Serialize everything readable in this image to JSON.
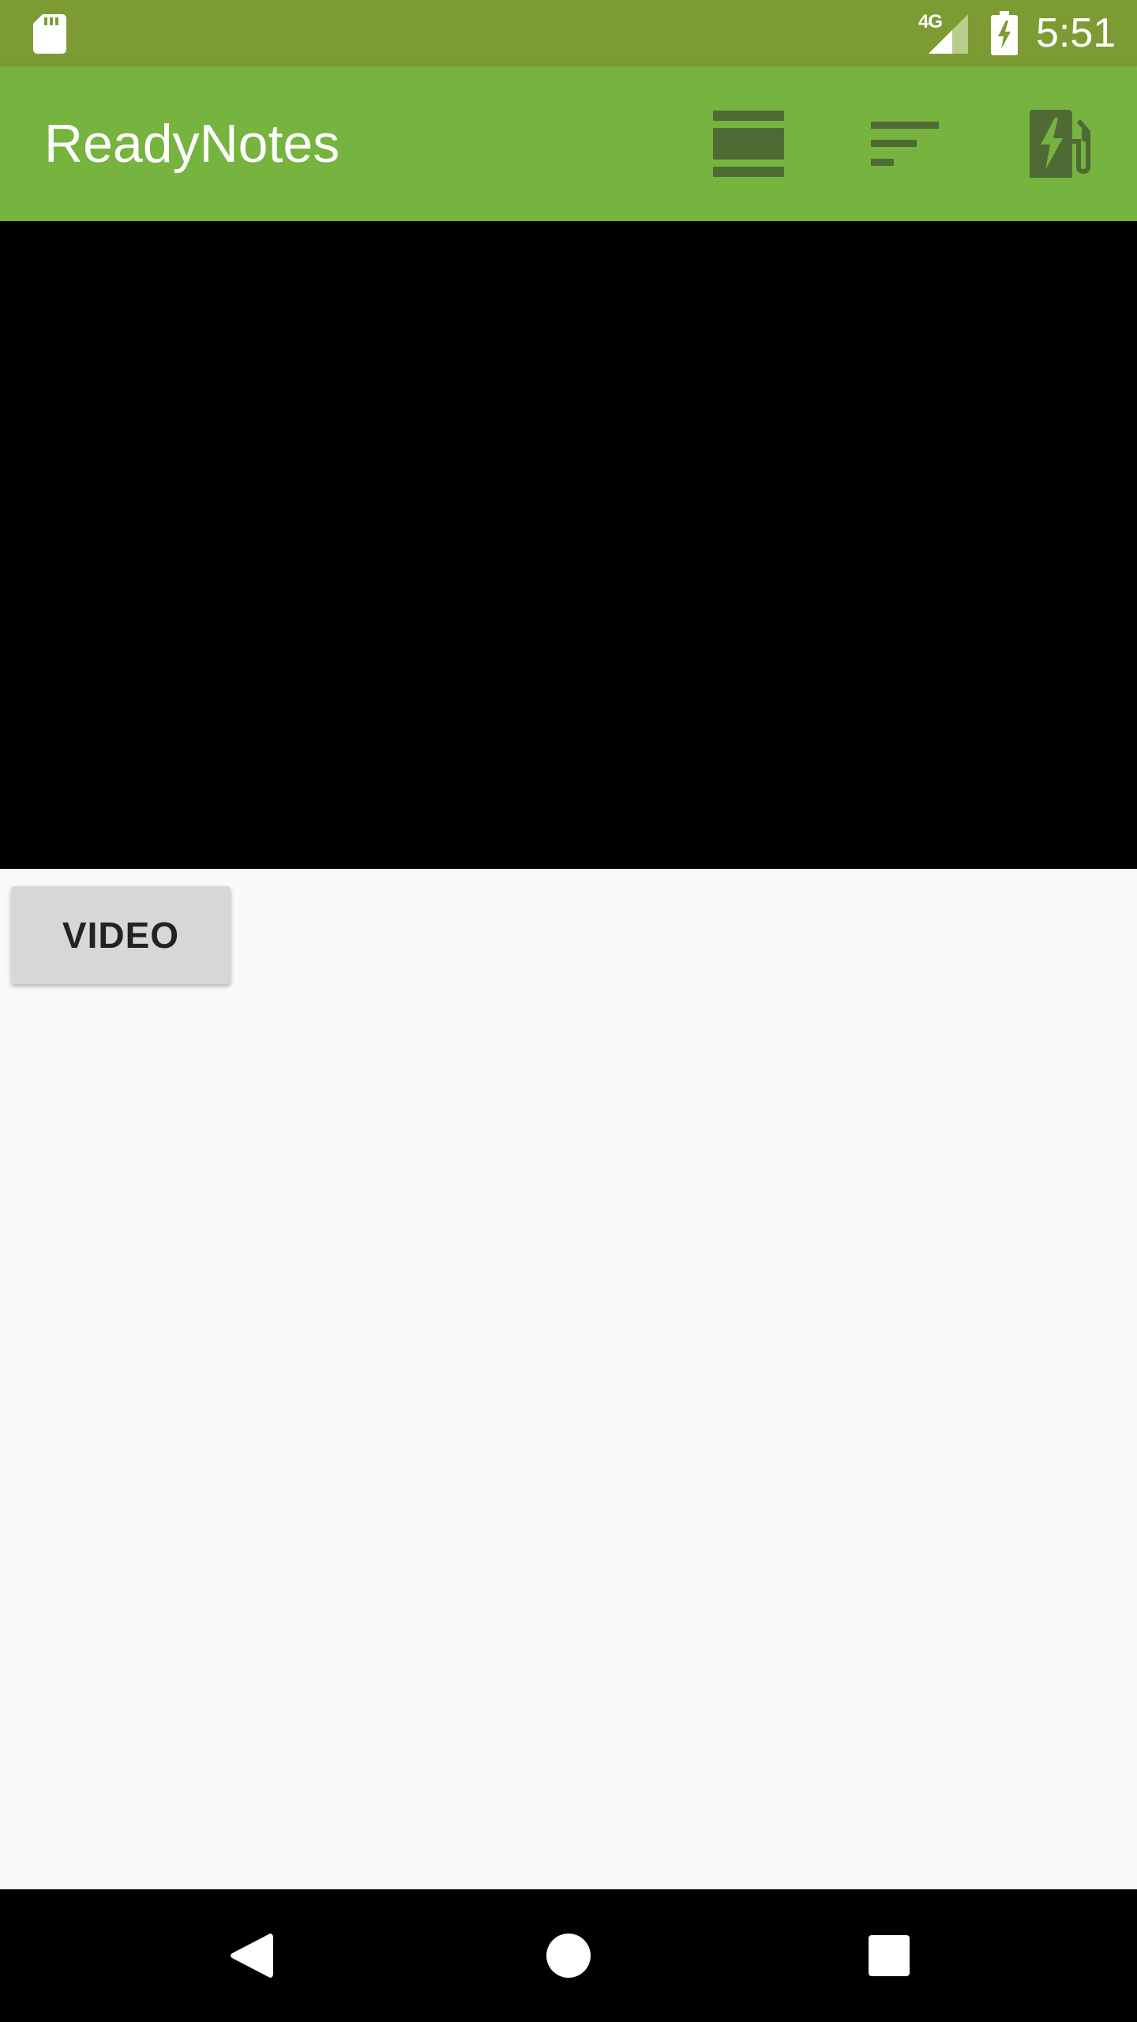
{
  "status_bar": {
    "network_type": "4G",
    "time": "5:51",
    "icons": [
      "sd-card-icon",
      "signal-icon",
      "battery-charging-icon"
    ]
  },
  "app_bar": {
    "title": "ReadyNotes",
    "actions": [
      {
        "icon": "view-stream-icon"
      },
      {
        "icon": "sort-icon"
      },
      {
        "icon": "ev-station-icon"
      }
    ]
  },
  "main": {
    "video_button_label": "VIDEO"
  },
  "nav_bar": {
    "buttons": [
      {
        "icon": "back-triangle-icon"
      },
      {
        "icon": "home-circle-icon"
      },
      {
        "icon": "recents-square-icon"
      }
    ]
  },
  "colors": {
    "status_bar": "#7c9b33",
    "app_bar": "#76b33f",
    "action_icon": "#4e6a35",
    "video_area": "#000000",
    "background": "#fafafa",
    "button": "#d6d7d7"
  }
}
